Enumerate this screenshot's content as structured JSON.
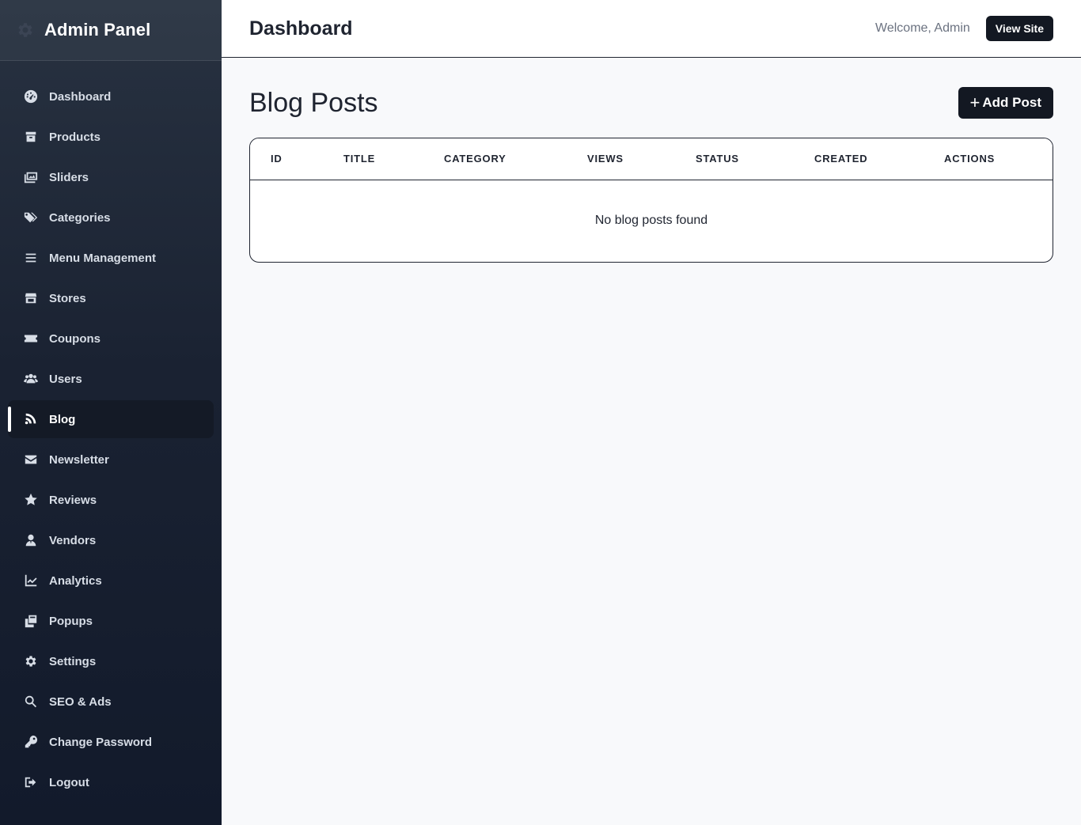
{
  "sidebar": {
    "title": "Admin Panel",
    "items": [
      {
        "label": "Dashboard",
        "icon": "dashboard-icon"
      },
      {
        "label": "Products",
        "icon": "box-icon"
      },
      {
        "label": "Sliders",
        "icon": "images-icon"
      },
      {
        "label": "Categories",
        "icon": "tags-icon"
      },
      {
        "label": "Menu Management",
        "icon": "bars-icon"
      },
      {
        "label": "Stores",
        "icon": "store-icon"
      },
      {
        "label": "Coupons",
        "icon": "ticket-icon"
      },
      {
        "label": "Users",
        "icon": "users-icon"
      },
      {
        "label": "Blog",
        "icon": "blog-icon",
        "active": true
      },
      {
        "label": "Newsletter",
        "icon": "envelope-icon"
      },
      {
        "label": "Reviews",
        "icon": "star-icon"
      },
      {
        "label": "Vendors",
        "icon": "user-tie-icon"
      },
      {
        "label": "Analytics",
        "icon": "chart-line-icon"
      },
      {
        "label": "Popups",
        "icon": "clone-icon"
      },
      {
        "label": "Settings",
        "icon": "gear-icon"
      },
      {
        "label": "SEO & Ads",
        "icon": "search-icon"
      },
      {
        "label": "Change Password",
        "icon": "key-icon"
      },
      {
        "label": "Logout",
        "icon": "logout-icon"
      }
    ]
  },
  "topbar": {
    "title": "Dashboard",
    "welcome": "Welcome, Admin",
    "view_site_label": "View Site"
  },
  "main": {
    "page_title": "Blog Posts",
    "add_post_label": "Add Post",
    "table": {
      "columns": [
        "ID",
        "TITLE",
        "CATEGORY",
        "VIEWS",
        "STATUS",
        "CREATED",
        "ACTIONS"
      ],
      "empty_message": "No blog posts found"
    }
  },
  "colors": {
    "sidebar_top": "#283241",
    "sidebar_bottom": "#121a2b",
    "button_dark": "#131822",
    "page_bg": "#f8f9fb"
  }
}
